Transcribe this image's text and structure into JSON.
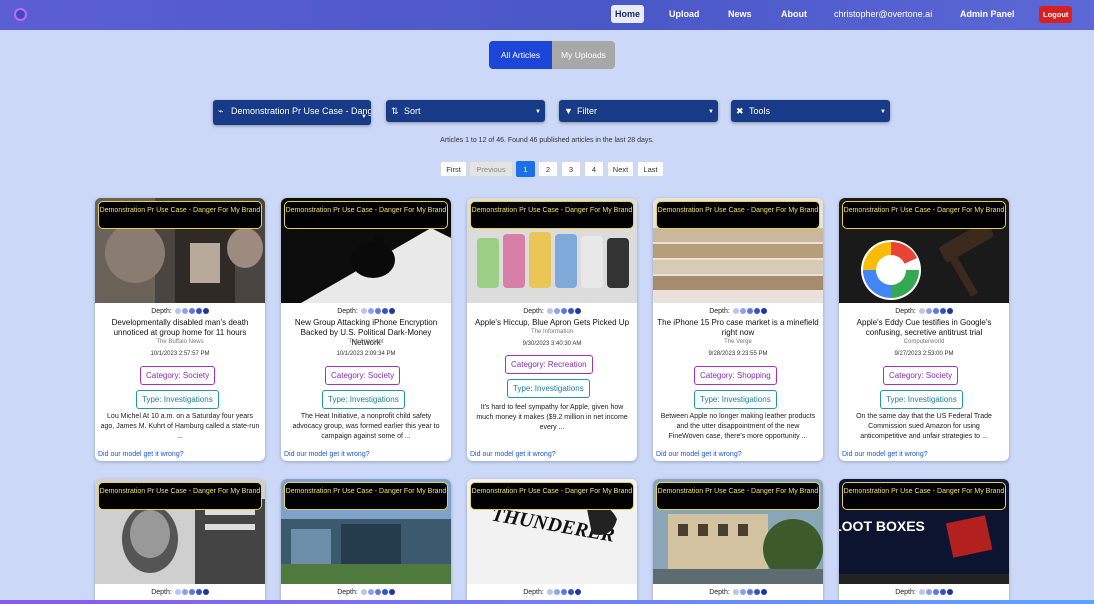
{
  "nav": {
    "home": "Home",
    "upload": "Upload",
    "news": "News",
    "about": "About",
    "user": "christopher@overtone.ai",
    "admin": "Admin Panel",
    "logout": "Logout"
  },
  "toggle": {
    "all": "All Articles",
    "mine": "My Uploads"
  },
  "controls": {
    "demo": "Demonstration Pr Use Case - Danger For My Brand",
    "sort": "Sort",
    "filter": "Filter",
    "tools": "Tools"
  },
  "summary": "Articles 1 to 12 of 46. Found 46 published articles in the last 28 days.",
  "pagination": {
    "first": "First",
    "previous": "Previous",
    "p1": "1",
    "p2": "2",
    "p3": "3",
    "p4": "4",
    "next": "Next",
    "last": "Last"
  },
  "card_common": {
    "badge": "Demonstration Pr Use Case - Danger For My Brand",
    "depth": "Depth:",
    "wrong": "Did our model get it wrong?"
  },
  "articles": [
    {
      "title": "Developmentally disabled man's death unnoticed at group home for 11 hours",
      "source": "The Buffalo News",
      "date": "10/1/2023 2:57:57 PM",
      "category": "Category: Society",
      "type": "Type: Investigations",
      "summary": "Lou Michel At 10 a.m. on a Saturday four years ago, James M. Kuhrt of Hamburg called a state-run ..."
    },
    {
      "title": "New Group Attacking iPhone Encryption Backed by U.S. Political Dark-Money Network",
      "source": "The Intercept",
      "date": "10/1/2023 2:09:34 PM",
      "category": "Category: Society",
      "type": "Type: Investigations",
      "summary": "The Heat Initiative, a nonprofit child safety advocacy group, was formed earlier this year to campaign against some of ..."
    },
    {
      "title": "Apple's Hiccup, Blue Apron Gets Picked Up",
      "source": "The Information",
      "date": "9/30/2023 3:40:30 AM",
      "category": "Category: Recreation",
      "type": "Type: Investigations",
      "summary": "It's hard to feel sympathy for Apple, given how much money it makes ($9.2 million in net income every ..."
    },
    {
      "title": "The iPhone 15 Pro case market is a minefield right now",
      "source": "The Verge",
      "date": "9/28/2023 9:23:55 PM",
      "category": "Category: Shopping",
      "type": "Type: Investigations",
      "summary": "Between Apple no longer making leather products and the utter disappointment of the new FineWoven case, there's more opportunity ..."
    },
    {
      "title": "Apple's Eddy Cue testifies in Google's confusing, secretive antitrust trial",
      "source": "Computerworld",
      "date": "9/27/2023 2:53:00 PM",
      "category": "Category: Society",
      "type": "Type: Investigations",
      "summary": "On the same day that the US Federal Trade Commission sued Amazon for using anticompetitive and unfair strategies to ..."
    }
  ],
  "second_row": [
    {
      "badge": "Demonstration Pr Use Case - Danger For My Brand"
    },
    {
      "badge": "Demonstration Pr Use Case - Danger For My Brand"
    },
    {
      "badge": "Demonstration Pr Use Case - Danger For My Brand",
      "image_text": "THUNDERER"
    },
    {
      "badge": "Demonstration Pr Use Case - Danger For My Brand"
    },
    {
      "badge": "Demonstration Pr Use Case - Danger For My Brand",
      "image_text": "LOOT BOXES"
    }
  ],
  "colors": {
    "nav_bg": "#4a57c7",
    "page_bg": "#cbd8f7",
    "control_bg": "#173b87",
    "primary": "#1c46d8",
    "category": "#a033c2",
    "type": "#2295a8",
    "link": "#1a55d8",
    "badge_border": "#e5d24a"
  }
}
